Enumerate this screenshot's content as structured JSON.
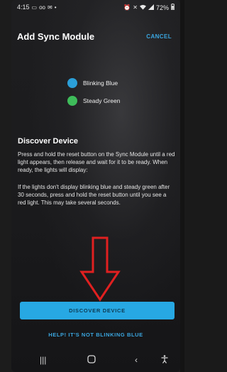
{
  "status_bar": {
    "time": "4:15",
    "battery": "72%"
  },
  "header": {
    "title": "Add Sync Module",
    "cancel_label": "CANCEL"
  },
  "legend": [
    {
      "label": "Blinking Blue",
      "color": "#2b9fd8"
    },
    {
      "label": "Steady Green",
      "color": "#3ebc5a"
    }
  ],
  "discover": {
    "title": "Discover Device",
    "paragraph1": "Press and hold the reset button on the Sync Module until a red light appears, then release and wait for it to be ready. When ready, the lights will display:",
    "paragraph2": "If the lights don't display blinking blue and steady green after 30 seconds, press and hold the reset button until you see a red light. This may take several seconds."
  },
  "buttons": {
    "discover_label": "DISCOVER DEVICE",
    "help_label": "HELP! IT'S NOT BLINKING BLUE"
  },
  "colors": {
    "accent": "#27a8e3",
    "arrow": "#e02020"
  }
}
